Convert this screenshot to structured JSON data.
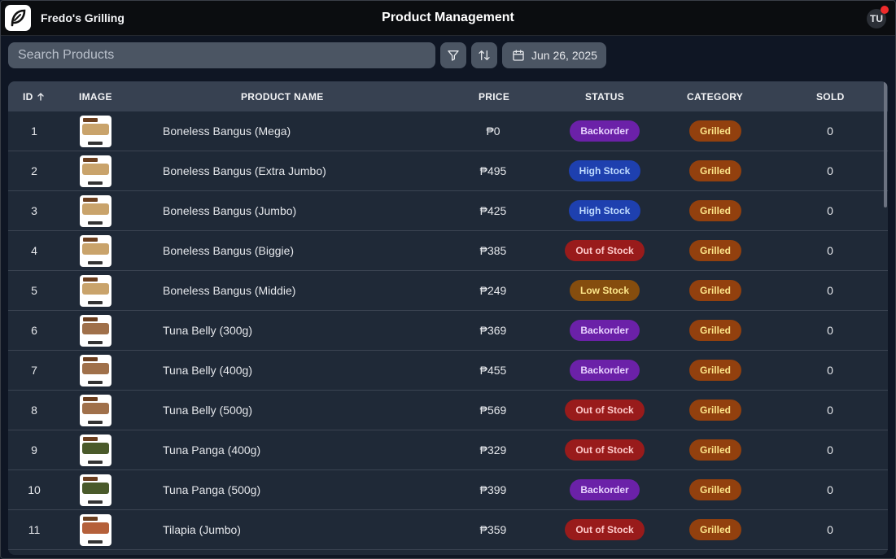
{
  "header": {
    "brand": "Fredo's Grilling",
    "title": "Product Management",
    "avatar_initials": "TU"
  },
  "toolbar": {
    "search_placeholder": "Search Products",
    "date_label": "Jun 26, 2025"
  },
  "table": {
    "columns": {
      "id": "ID",
      "image": "IMAGE",
      "name": "PRODUCT NAME",
      "price": "PRICE",
      "status": "STATUS",
      "category": "CATEGORY",
      "sold": "SOLD"
    },
    "rows": [
      {
        "id": "1",
        "name": "Boneless Bangus (Mega)",
        "price": "₱0",
        "status": "Backorder",
        "category": "Grilled",
        "sold": "0",
        "thumb": "bangus"
      },
      {
        "id": "2",
        "name": "Boneless Bangus (Extra Jumbo)",
        "price": "₱495",
        "status": "High Stock",
        "category": "Grilled",
        "sold": "0",
        "thumb": "bangus"
      },
      {
        "id": "3",
        "name": "Boneless Bangus (Jumbo)",
        "price": "₱425",
        "status": "High Stock",
        "category": "Grilled",
        "sold": "0",
        "thumb": "bangus"
      },
      {
        "id": "4",
        "name": "Boneless Bangus (Biggie)",
        "price": "₱385",
        "status": "Out of Stock",
        "category": "Grilled",
        "sold": "0",
        "thumb": "bangus"
      },
      {
        "id": "5",
        "name": "Boneless Bangus (Middie)",
        "price": "₱249",
        "status": "Low Stock",
        "category": "Grilled",
        "sold": "0",
        "thumb": "bangus"
      },
      {
        "id": "6",
        "name": "Tuna Belly (300g)",
        "price": "₱369",
        "status": "Backorder",
        "category": "Grilled",
        "sold": "0",
        "thumb": "tuna"
      },
      {
        "id": "7",
        "name": "Tuna Belly (400g)",
        "price": "₱455",
        "status": "Backorder",
        "category": "Grilled",
        "sold": "0",
        "thumb": "tuna"
      },
      {
        "id": "8",
        "name": "Tuna Belly (500g)",
        "price": "₱569",
        "status": "Out of Stock",
        "category": "Grilled",
        "sold": "0",
        "thumb": "tuna"
      },
      {
        "id": "9",
        "name": "Tuna Panga (400g)",
        "price": "₱329",
        "status": "Out of Stock",
        "category": "Grilled",
        "sold": "0",
        "thumb": "panga"
      },
      {
        "id": "10",
        "name": "Tuna Panga (500g)",
        "price": "₱399",
        "status": "Backorder",
        "category": "Grilled",
        "sold": "0",
        "thumb": "panga"
      },
      {
        "id": "11",
        "name": "Tilapia (Jumbo)",
        "price": "₱359",
        "status": "Out of Stock",
        "category": "Grilled",
        "sold": "0",
        "thumb": "tilapia"
      }
    ]
  },
  "colors": {
    "status": {
      "Backorder": {
        "bg": "#6b21a8",
        "fg": "#e9d5ff"
      },
      "High Stock": {
        "bg": "#1e40af",
        "fg": "#bfdbfe"
      },
      "Out of Stock": {
        "bg": "#991b1b",
        "fg": "#fecaca"
      },
      "Low Stock": {
        "bg": "#854d0e",
        "fg": "#fde68a"
      }
    },
    "category": {
      "Grilled": {
        "bg": "#92400e",
        "fg": "#fde68a"
      }
    },
    "thumb": {
      "bangus": "#c9a36b",
      "tuna": "#a0704a",
      "panga": "#4a5a2a",
      "tilapia": "#b5603a"
    }
  }
}
